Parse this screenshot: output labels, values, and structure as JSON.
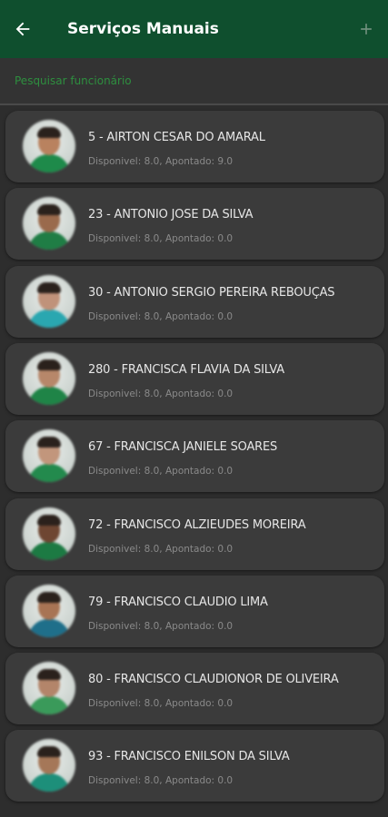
{
  "appbar": {
    "title": "Serviços Manuais",
    "back_icon": "arrow-left-icon",
    "add_icon": "plus-icon",
    "background_color": "#0f4f2e"
  },
  "search": {
    "placeholder": "Pesquisar funcionário",
    "value": "",
    "placeholder_color": "#2e8f3f"
  },
  "employees": [
    {
      "label": "5 - AIRTON CESAR DO AMARAL",
      "info": "Disponivel: 8.0, Apontado: 9.0",
      "skin": "#b9825f",
      "shirt": "#1e8a4a"
    },
    {
      "label": "23 - ANTONIO JOSE DA SILVA",
      "info": "Disponivel: 8.0, Apontado: 0.0",
      "skin": "#9a6a4c",
      "shirt": "#1f7d45"
    },
    {
      "label": "30 - ANTONIO SERGIO PEREIRA REBOUÇAS",
      "info": "Disponivel: 8.0, Apontado: 0.0",
      "skin": "#c0927a",
      "shirt": "#2aa7b0"
    },
    {
      "label": "280 - FRANCISCA FLAVIA DA SILVA",
      "info": "Disponivel: 8.0, Apontado: 0.0",
      "skin": "#b7876a",
      "shirt": "#1f8447"
    },
    {
      "label": "67 - FRANCISCA JANIELE SOARES",
      "info": "Disponivel: 8.0, Apontado: 0.0",
      "skin": "#c2967c",
      "shirt": "#238a4d"
    },
    {
      "label": "72 - FRANCISCO ALZIEUDES MOREIRA",
      "info": "Disponivel: 8.0, Apontado: 0.0",
      "skin": "#6e4632",
      "shirt": "#1c7a43"
    },
    {
      "label": "79 - FRANCISCO CLAUDIO LIMA",
      "info": "Disponivel: 8.0, Apontado: 0.0",
      "skin": "#a87454",
      "shirt": "#1f6f8a"
    },
    {
      "label": "80 - FRANCISCO CLAUDIONOR DE OLIVEIRA",
      "info": "Disponivel: 8.0, Apontado: 0.0",
      "skin": "#b3856a",
      "shirt": "#3a9a5a"
    },
    {
      "label": "93 - FRANCISCO ENILSON DA SILVA",
      "info": "Disponivel: 8.0, Apontado: 0.0",
      "skin": "#a57758",
      "shirt": "#1d8f7a"
    }
  ]
}
